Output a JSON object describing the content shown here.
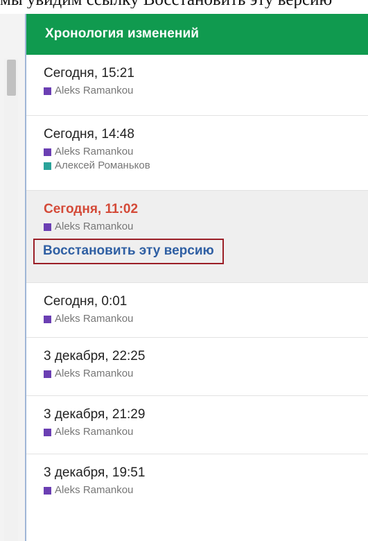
{
  "top_caption": "мы увидим ссылку Восстановить эту версию",
  "panel": {
    "title": "Хронология изменений"
  },
  "colors": {
    "header_bg": "#109a4f",
    "purple_author": "#6b3fb3",
    "teal_author": "#2aa39a",
    "selected_time": "#d44a38",
    "restore_link": "#2f5fa3",
    "highlight_border": "#9b1f27"
  },
  "revisions": [
    {
      "time": "Сегодня, 15:21",
      "authors": [
        {
          "name": "Aleks Ramankou",
          "color": "purple"
        }
      ]
    },
    {
      "time": "Сегодня, 14:48",
      "authors": [
        {
          "name": "Aleks Ramankou",
          "color": "purple"
        },
        {
          "name": "Алексей Романьков",
          "color": "teal"
        }
      ]
    },
    {
      "time": "Сегодня, 11:02",
      "selected": true,
      "authors": [
        {
          "name": "Aleks Ramankou",
          "color": "purple"
        }
      ],
      "restore_label": "Восстановить эту версию"
    },
    {
      "time": "Сегодня, 0:01",
      "authors": [
        {
          "name": "Aleks Ramankou",
          "color": "purple"
        }
      ]
    },
    {
      "time": "3 декабря, 22:25",
      "authors": [
        {
          "name": "Aleks Ramankou",
          "color": "purple"
        }
      ]
    },
    {
      "time": "3 декабря, 21:29",
      "authors": [
        {
          "name": "Aleks Ramankou",
          "color": "purple"
        }
      ]
    },
    {
      "time": "3 декабря, 19:51",
      "authors": [
        {
          "name": "Aleks Ramankou",
          "color": "purple"
        }
      ]
    }
  ]
}
